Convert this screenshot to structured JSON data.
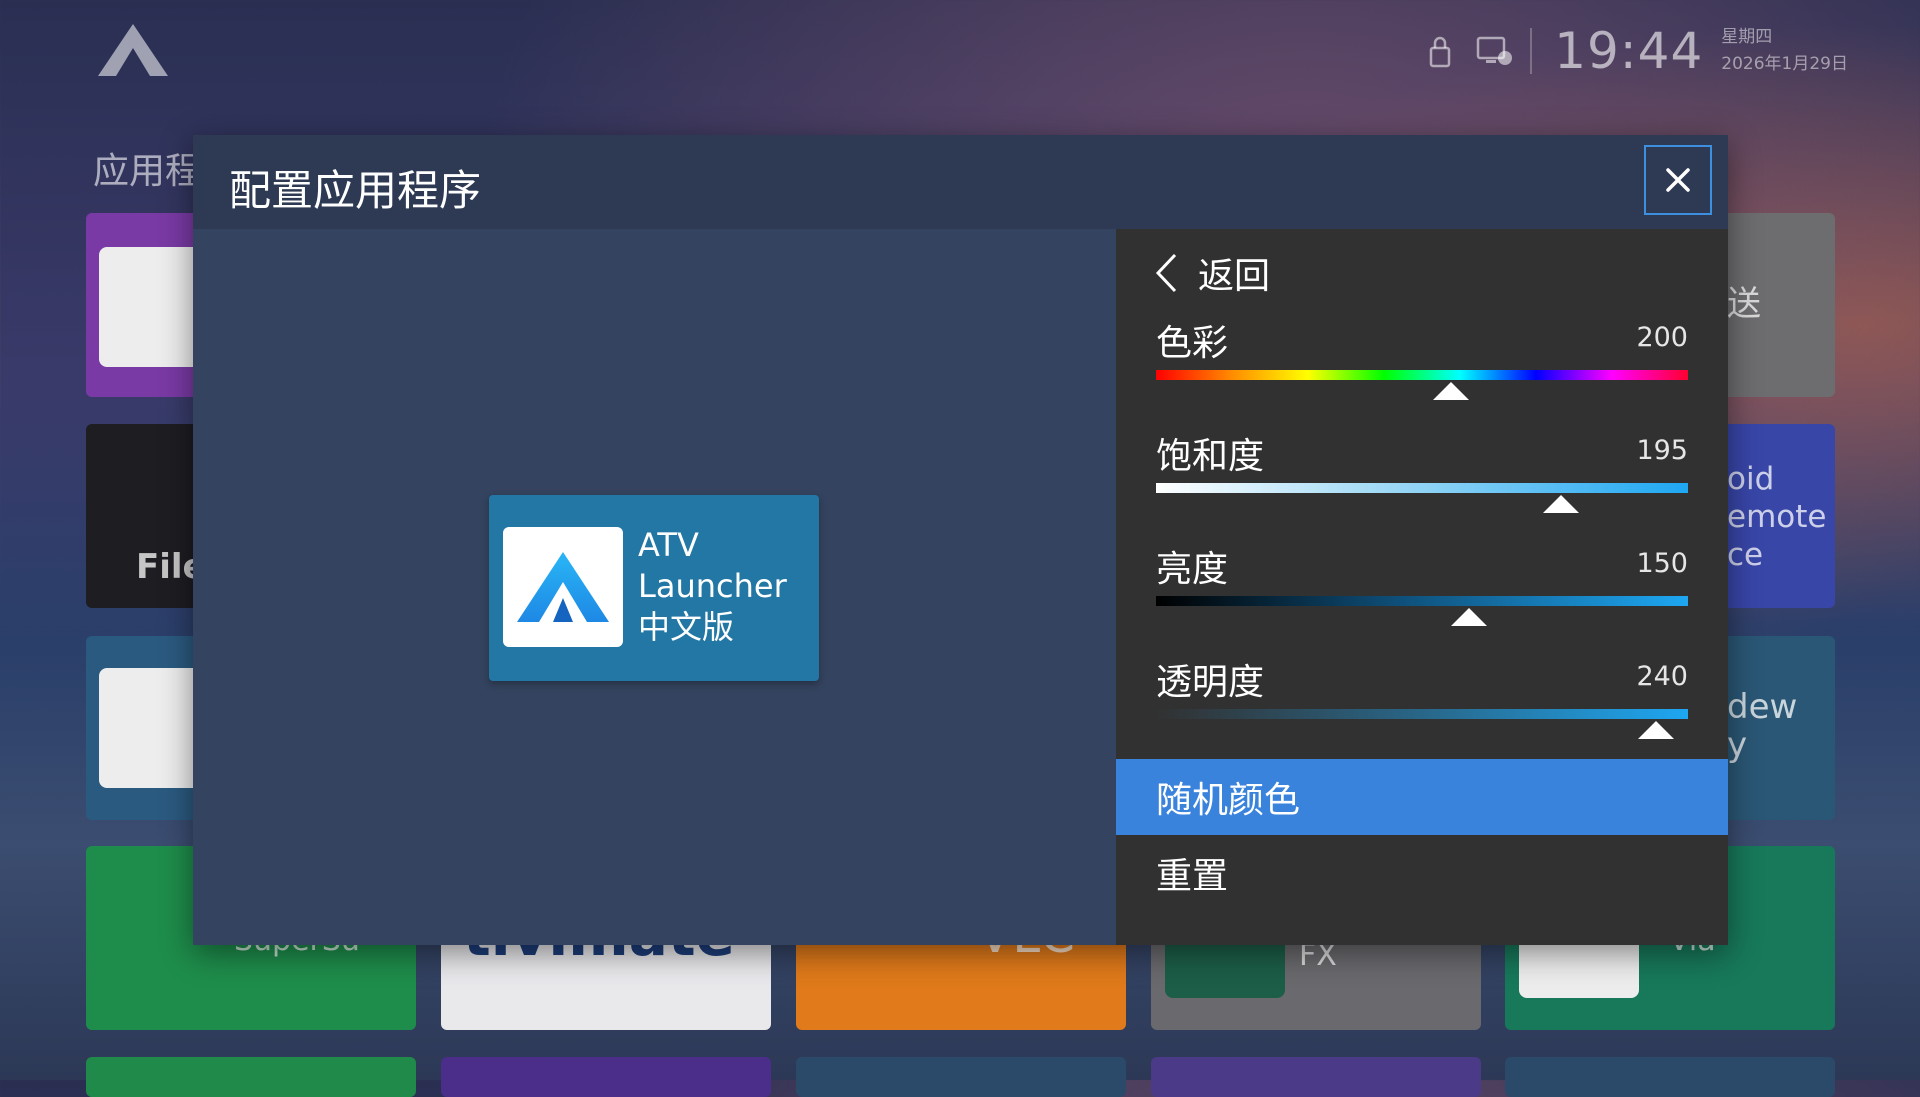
{
  "background": {
    "section_label": "应用程",
    "status": {
      "time": "19:44",
      "weekday": "星期四",
      "date": "2026年1月29日"
    },
    "tiles": {
      "file_label": "File",
      "tile_top_right": "送",
      "tile_remote": "oid\nemote\nce",
      "tile_dew": "dew\ny",
      "superso": "SuperSu",
      "tivimate": "tivimate",
      "vlc": "VLC",
      "android_fx": "Android\nFX",
      "via": "Via"
    }
  },
  "dialog": {
    "title": "配置应用程序",
    "close_icon": "close-icon",
    "app": {
      "name": "ATV\nLauncher\n中文版"
    },
    "panel": {
      "back_label": "返回",
      "sliders": [
        {
          "label": "色彩",
          "value": "200",
          "fraction": 0.555
        },
        {
          "label": "饱和度",
          "value": "195",
          "fraction": 0.762
        },
        {
          "label": "亮度",
          "value": "150",
          "fraction": 0.588
        },
        {
          "label": "透明度",
          "value": "240",
          "fraction": 0.94
        }
      ],
      "menu": [
        {
          "label": "随机颜色",
          "selected": true
        },
        {
          "label": "重置",
          "selected": false
        }
      ]
    }
  },
  "colors": {
    "accent": "#3a83dc",
    "card": "#2277a4",
    "panel_bg": "#313131",
    "dialog_bg": "#33405b"
  }
}
